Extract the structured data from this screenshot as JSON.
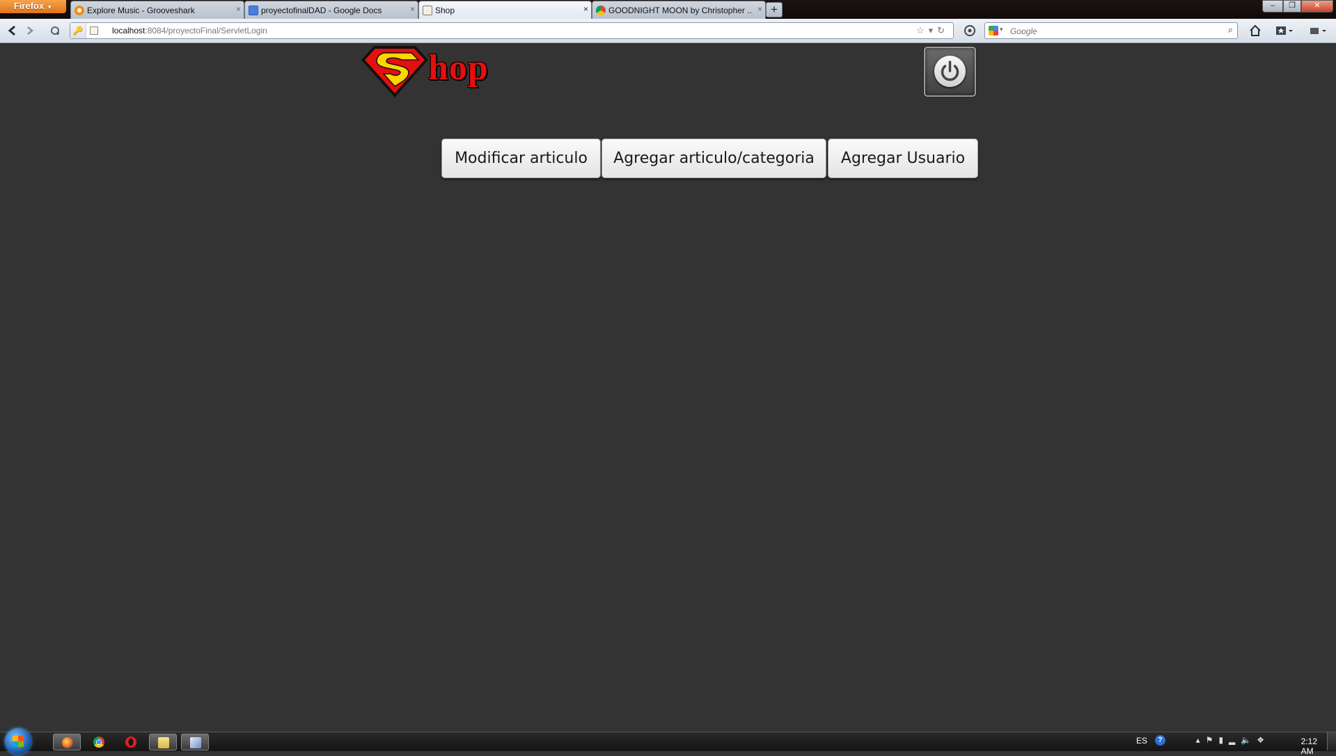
{
  "browser": {
    "menu_button_label": "Firefox",
    "tabs": [
      {
        "label": "Explore Music - Grooveshark",
        "icon": "grooveshark-icon",
        "active": false
      },
      {
        "label": "proyectofinalDAD - Google Docs",
        "icon": "google-docs-icon",
        "active": false
      },
      {
        "label": "Shop",
        "icon": "page-icon",
        "active": true
      },
      {
        "label": "GOODNIGHT MOON by Christopher ...",
        "icon": "chrome-icon",
        "active": false
      }
    ],
    "tab_close_glyph": "×",
    "new_tab_glyph": "+",
    "url_host": "localhost",
    "url_rest": ":8084/proyectoFinal/ServletLogin",
    "search_placeholder": "Google",
    "window_controls": {
      "minimize": "‒",
      "maximize": "❐",
      "close": "✕"
    }
  },
  "page": {
    "logo_text": "hop",
    "power_button_icon": "power-icon",
    "buttons": {
      "modify": "Modificar articulo",
      "add_article": "Agregar articulo/categoria",
      "add_user": "Agregar Usuario"
    }
  },
  "taskbar": {
    "apps": [
      "firefox-icon",
      "chrome-icon",
      "opera-icon",
      "folders-icon",
      "virtualbox-icon"
    ],
    "language": "ES",
    "help_glyph": "?",
    "time": "2:12 AM"
  },
  "colors": {
    "page_background": "#333333",
    "logo_red": "#e50f0f",
    "shield_yellow": "#ffd400",
    "firefox_orange": "#e87b22"
  }
}
